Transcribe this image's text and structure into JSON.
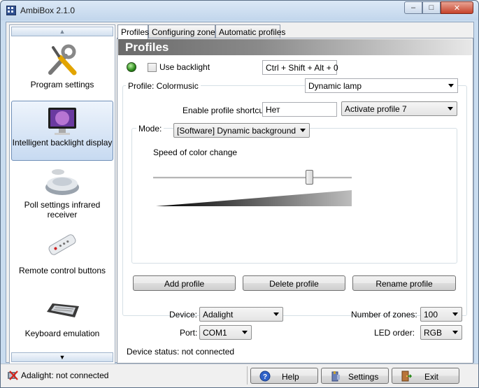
{
  "window": {
    "title": "AmbiBox 2.1.0"
  },
  "sidebar": {
    "items": [
      {
        "label": "Program settings",
        "icon": "tools-icon"
      },
      {
        "label": "Intelligent backlight display",
        "icon": "monitor-icon"
      },
      {
        "label": "Poll settings infrared receiver",
        "icon": "ir-receiver-icon"
      },
      {
        "label": "Remote control buttons",
        "icon": "remote-control-icon"
      },
      {
        "label": "Keyboard emulation",
        "icon": "keyboard-icon"
      }
    ]
  },
  "tabs": [
    {
      "label": "Profiles"
    },
    {
      "label": "Configuring zones"
    },
    {
      "label": "Automatic profiles"
    }
  ],
  "profiles": {
    "header": "Profiles",
    "use_backlight_label": "Use backlight",
    "hotkey": "Ctrl + Shift + Alt + 0",
    "profile_label": "Profile: Colormusic",
    "profile_value": "Dynamic lamp",
    "enable_shortcut_label": "Enable profile shortcut:",
    "shortcut_value": "Нет",
    "activate_value": "Activate profile 7",
    "mode_label": "Mode:",
    "mode_value": "[Software] Dynamic background",
    "speed_label": "Speed of color change",
    "speed_level": 0.8,
    "add_label": "Add profile",
    "delete_label": "Delete profile",
    "rename_label": "Rename profile"
  },
  "device": {
    "device_label": "Device:",
    "device_value": "Adalight",
    "port_label": "Port:",
    "port_value": "COM1",
    "zones_label": "Number of zones:",
    "zones_value": "100",
    "led_order_label": "LED order:",
    "led_order_value": "RGB",
    "status_text": "Device status: not connected"
  },
  "statusbar": {
    "text": "Adalight: not connected",
    "help_label": "Help",
    "settings_label": "Settings",
    "exit_label": "Exit"
  },
  "colors": {
    "led_on": "#2b8a1b",
    "header_dark": "#6a6a6a",
    "selection": "#c7daf1"
  }
}
